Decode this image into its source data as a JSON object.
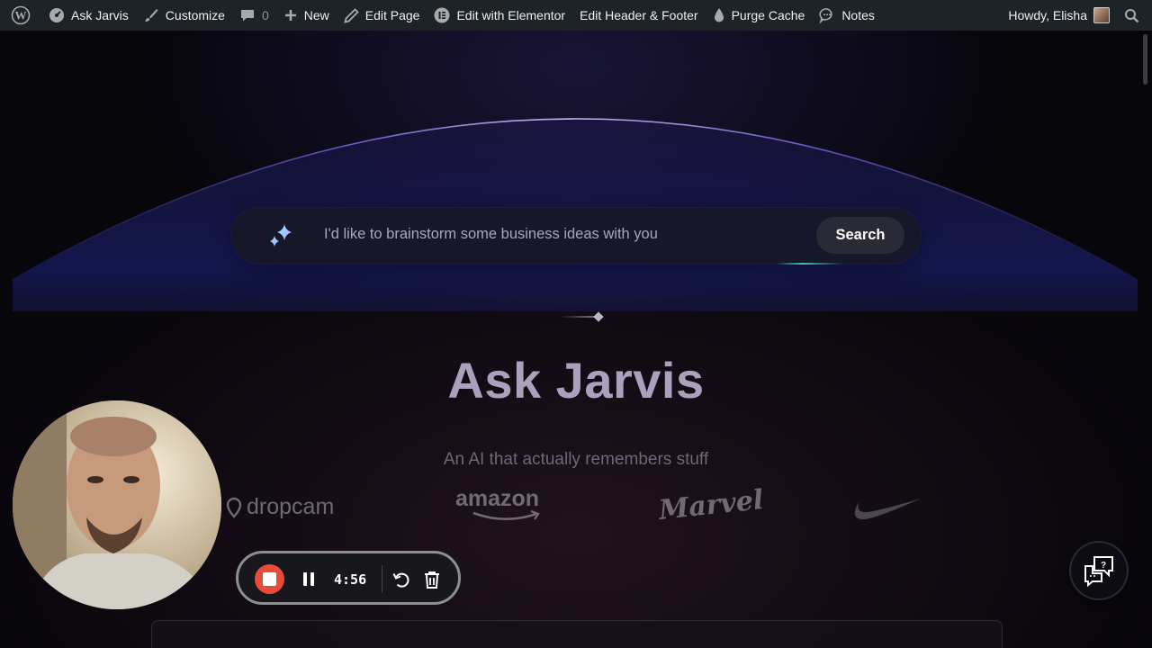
{
  "adminbar": {
    "site_name": "Ask Jarvis",
    "customize": "Customize",
    "comments_count": "0",
    "new": "New",
    "edit_page": "Edit Page",
    "edit_elementor": "Edit with Elementor",
    "edit_header_footer": "Edit Header & Footer",
    "purge_cache": "Purge Cache",
    "notes": "Notes",
    "howdy": "Howdy, Elisha"
  },
  "search": {
    "placeholder": "I'd like to brainstorm some business ideas with you",
    "button_label": "Search"
  },
  "hero": {
    "title": "Ask Jarvis",
    "subtitle": "An AI that actually remembers stuff"
  },
  "logos": {
    "dropcam": "dropcam",
    "amazon": "amazon",
    "marvel": "Marvel"
  },
  "recorder": {
    "time": "4:56"
  },
  "colors": {
    "adminbar_bg": "#1d2327",
    "page_bg": "#07060b",
    "record_red": "#e64b3c",
    "title_color": "#aca1bc",
    "arc_accent": "#8a7cf0"
  }
}
